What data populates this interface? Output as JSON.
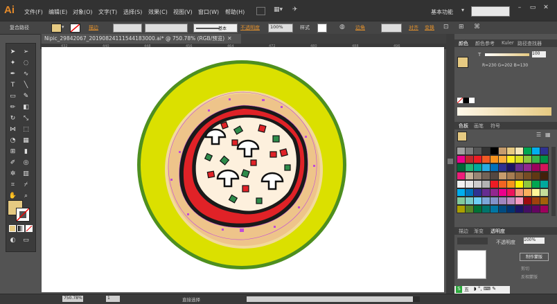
{
  "app": {
    "logo": "Ai"
  },
  "menu": [
    "文件(F)",
    "编辑(E)",
    "对象(O)",
    "文字(T)",
    "选择(S)",
    "效果(C)",
    "视图(V)",
    "窗口(W)",
    "帮助(H)"
  ],
  "workspace": {
    "label": "基本功能"
  },
  "controlbar": {
    "selection": "复合路径",
    "stroke_label": "描边",
    "profile_label": "基本",
    "opacity_label": "不透明度",
    "opacity_value": "100%",
    "style_label": "样式",
    "corner_label": "边角",
    "align_label": "对齐",
    "transform_label": "变换"
  },
  "document": {
    "tab": "Nipic_29842067_20190824111544183000.ai* @ 750.78% (RGB/预览)"
  },
  "ruler": {
    "ticks": [
      "432",
      "440",
      "448",
      "456",
      "464",
      "472",
      "480",
      "488",
      "496"
    ]
  },
  "status": {
    "zoom": "750.78%",
    "page": "1",
    "tool": "直接选择"
  },
  "color_panel": {
    "tabs": [
      "颜色",
      "颜色参考",
      "Kuler",
      "路径查找器"
    ],
    "readout": "R=230  G=202  B=130",
    "slider_value": "100",
    "fill_color": "#E6CA82"
  },
  "swatches_panel": {
    "tabs": [
      "色板",
      "画笔",
      "符号"
    ],
    "colors": [
      "#ffffff",
      "#8ec63f",
      "#5dc9f0",
      "#f7a8c7",
      "#ed1c24",
      "#f7941d",
      "#ffde00",
      "#8dc63f",
      "#00a651",
      "#00aeef",
      "#2e3192",
      "#ec008c",
      "#c1272d",
      "#ed1c24",
      "#f15a24",
      "#f7931e",
      "#fbb03b",
      "#fcee21",
      "#d9e021",
      "#8cc63f",
      "#39b54a",
      "#009245",
      "#006837",
      "#22b573",
      "#00a99d",
      "#29abe2",
      "#0071bc",
      "#2e3192",
      "#1b1464",
      "#662d91",
      "#93278f",
      "#9e005d",
      "#d4145a",
      "#ed1e79",
      "#c7b299",
      "#998675",
      "#736357",
      "#534741",
      "#c69c6d",
      "#a67c52",
      "#8c6239",
      "#754c24",
      "#603813",
      "#42210b",
      "#f2f2f2",
      "#e6e6e6",
      "#cccccc",
      "#b3b3b3",
      "#ed1c24",
      "#f26522",
      "#f7941d",
      "#fff200",
      "#8dc63f",
      "#00a651",
      "#00a99d",
      "#00aeef",
      "#0072bc",
      "#2e3192",
      "#662d91",
      "#92278f",
      "#ec008c",
      "#ed145b",
      "#f69679",
      "#fbaf5d",
      "#fff799",
      "#c4df9b",
      "#82ca9c",
      "#7accc8",
      "#6dcff6",
      "#7da7d9",
      "#8393ca",
      "#a186be",
      "#bd8cbf",
      "#f49ac1",
      "#9e0b0f",
      "#a0410d",
      "#a3620a",
      "#aba000",
      "#598527",
      "#007236",
      "#00746b",
      "#0076a3",
      "#004a80",
      "#003471",
      "#1b1464",
      "#440e62",
      "#630460",
      "#9e005d",
      "#a0a0a0",
      "#7b7b7b",
      "#555555",
      "#333333",
      "#000000",
      "#c69c6d",
      "#e6ca82",
      "#f5e6b8"
    ]
  },
  "transparency_panel": {
    "tabs": [
      "描边",
      "渐变",
      "透明度"
    ],
    "opacity_label": "不透明度",
    "opacity_value": "100%",
    "make_mask": "制作蒙版",
    "clip": "剪切",
    "invert": "反相蒙版"
  },
  "ime_bar": {
    "label": "五"
  }
}
